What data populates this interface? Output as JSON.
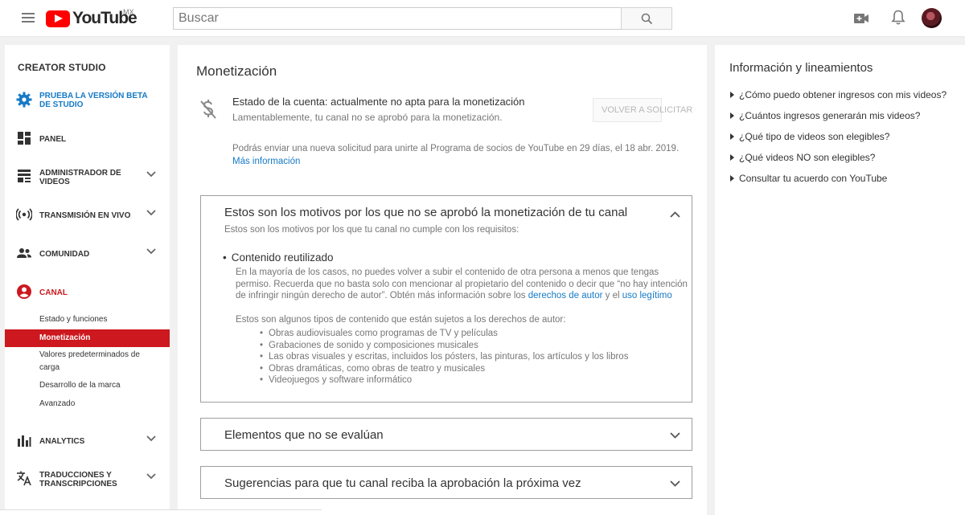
{
  "header": {
    "logo_text": "YouTube",
    "country_code": "MX",
    "search_placeholder": "Buscar",
    "icons": [
      "menu-icon",
      "search-icon",
      "video-camera-icon",
      "bell-icon"
    ]
  },
  "sidebar": {
    "title": "CREATOR STUDIO",
    "beta_line1": "PRUEBA LA VERSIÓN BETA",
    "beta_line2": "DE STUDIO",
    "panel": "PANEL",
    "admin_line1": "ADMINISTRADOR DE",
    "admin_line2": "VIDEOS",
    "live": "TRANSMISIÓN EN VIVO",
    "community": "COMUNIDAD",
    "channel": "CANAL",
    "sub_items": {
      "status": "Estado y funciones",
      "monetization": "Monetización",
      "defaults_line1": "Valores predeterminados de",
      "defaults_line2": "carga",
      "branding": "Desarrollo de la marca",
      "advanced": "Avanzado"
    },
    "analytics": "ANALYTICS",
    "trans_line1": "TRADUCCIONES Y",
    "trans_line2": "TRANSCRIPCIONES",
    "accent_color": "#cc181e",
    "beta_color": "#167ac6"
  },
  "main": {
    "title": "Monetización",
    "status_title": "Estado de la cuenta: actualmente no apta para la monetización",
    "status_sub": "Lamentablemente, tu canal no se aprobó para la monetización.",
    "reapply_label": "VOLVER A SOLICITAR",
    "reapply_note": "Podrás enviar una nueva solicitud para unirte al Programa de socios de YouTube en 29 días, el 18 abr. 2019.",
    "more_info": "Más información",
    "panel1": {
      "title": "Estos son los motivos por los que no se aprobó la monetización de tu canal",
      "subtitle": "Estos son los motivos por los que tu canal no cumple con los requisitos:",
      "bullet_title": "Contenido reutilizado",
      "body_part1": "En la mayoría de los casos, no puedes volver a subir el contenido de otra persona a menos que tengas permiso. Recuerda que no basta solo con mencionar al propietario del contenido o decir que “no hay intención de infringir ningún derecho de autor”. Obtén más información sobre los ",
      "link_copyright": "derechos de autor",
      "body_part2": " y el ",
      "link_fair_use": "uso legítimo",
      "types_lead": "Estos son algunos tipos de contenido que están sujetos a los derechos de autor:",
      "types": [
        "Obras audiovisuales como programas de TV y películas",
        "Grabaciones de sonido y composiciones musicales",
        "Las obras visuales y escritas, incluidos los pósters, las pinturas, los artículos y los libros",
        "Obras dramáticas, como obras de teatro y musicales",
        "Videojuegos y software informático"
      ]
    },
    "panel2_title": "Elementos que no se evalúan",
    "panel3_title": "Sugerencias para que tu canal reciba la aprobación la próxima vez"
  },
  "right": {
    "title": "Información y lineamientos",
    "links": [
      "¿Cómo puedo obtener ingresos con mis videos?",
      "¿Cuántos ingresos generarán mis videos?",
      "¿Qué tipo de videos son elegibles?",
      "¿Qué videos NO son elegibles?",
      "Consultar tu acuerdo con YouTube"
    ]
  }
}
